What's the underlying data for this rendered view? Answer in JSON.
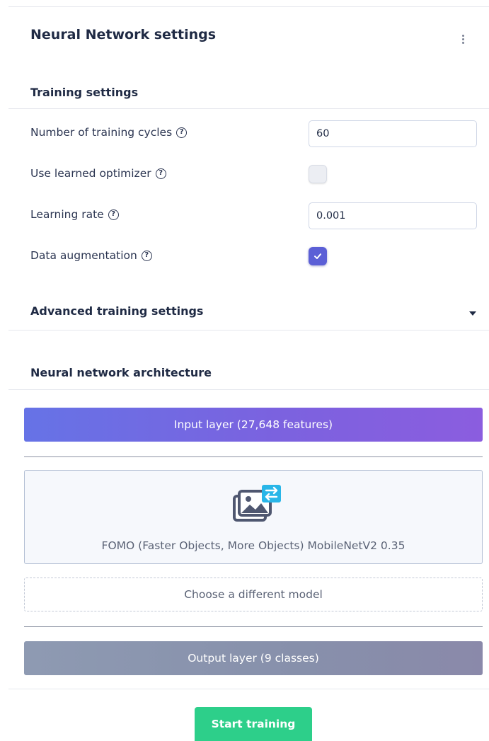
{
  "panel": {
    "title": "Neural Network settings",
    "menu_icon": "kebab-menu-icon"
  },
  "training": {
    "title": "Training settings",
    "cycles": {
      "label": "Number of training cycles",
      "value": "60"
    },
    "optimizer": {
      "label": "Use learned optimizer",
      "checked": false
    },
    "learning_rate": {
      "label": "Learning rate",
      "value": "0.001"
    },
    "augmentation": {
      "label": "Data augmentation",
      "checked": true
    },
    "help_glyph": "?"
  },
  "advanced": {
    "title": "Advanced training settings",
    "expand_icon": "caret-down-icon"
  },
  "architecture": {
    "title": "Neural network architecture",
    "input_layer": "Input layer (27,648 features)",
    "model": {
      "name": "FOMO (Faster Objects, More Objects) MobileNetV2 0.35",
      "icon": "image-swap-icon"
    },
    "choose_model": "Choose a different model",
    "output_layer": "Output layer (9 classes)"
  },
  "actions": {
    "start_training": "Start training"
  },
  "colors": {
    "accent": "#5b5fd6",
    "start_button": "#2dcf8a",
    "input_layer_gradient": [
      "#6673e6",
      "#8b5ddf"
    ],
    "output_layer_gradient": [
      "#8e9ab2",
      "#8a89aa"
    ],
    "icon_badge": "#29b6e8"
  }
}
